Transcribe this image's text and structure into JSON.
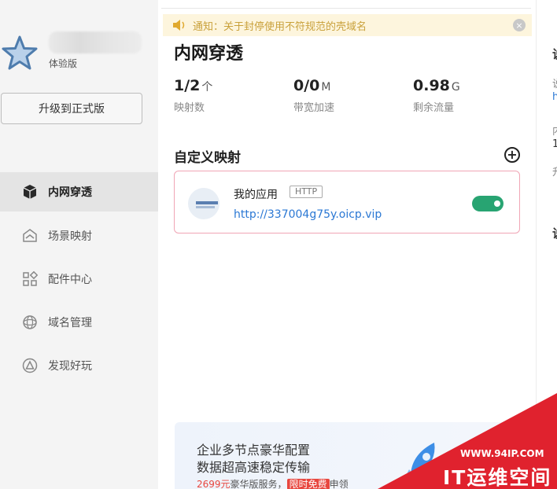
{
  "sidebar": {
    "plan": "体验版",
    "upgrade_label": "升级到正式版",
    "nav": [
      {
        "label": "内网穿透",
        "icon": "cube-icon"
      },
      {
        "label": "场景映射",
        "icon": "scene-icon"
      },
      {
        "label": "配件中心",
        "icon": "grid-icon"
      },
      {
        "label": "域名管理",
        "icon": "domain-icon"
      },
      {
        "label": "发现好玩",
        "icon": "discover-icon"
      }
    ]
  },
  "notice": {
    "text": "通知：关于封停使用不符规范的壳域名",
    "close": "×"
  },
  "main": {
    "title": "内网穿透",
    "stats": [
      {
        "value": "1/2",
        "unit": "个",
        "label": "映射数"
      },
      {
        "value": "0/0",
        "unit": "M",
        "label": "带宽加速"
      },
      {
        "value": "0.98",
        "unit": "G",
        "label": "剩余流量"
      }
    ],
    "section_title": "自定义映射",
    "add": "+",
    "mapping": {
      "name": "我的应用",
      "protocol": "HTTP",
      "url": "http://337004g75y.oicp.vip",
      "enabled": true
    }
  },
  "banner": {
    "line1": "企业多节点豪华配置",
    "line2": "数据超高速稳定传输",
    "price": "2699元",
    "service": "豪华版服务，",
    "badge": "限时免费",
    "action": "申领"
  },
  "right_panel": {
    "chars": [
      "说",
      "说",
      "h",
      "内",
      "1",
      "升",
      "说"
    ]
  },
  "watermark": {
    "url": "WWW.94IP.COM",
    "text": "IT运维空间"
  },
  "colors": {
    "accent_green": "#28a472",
    "link_blue": "#2b78d4",
    "card_border": "#f0a5b5",
    "notice_bg": "#fdf5dd",
    "notice_text": "#c9a13b",
    "watermark_red": "#e0222e"
  }
}
